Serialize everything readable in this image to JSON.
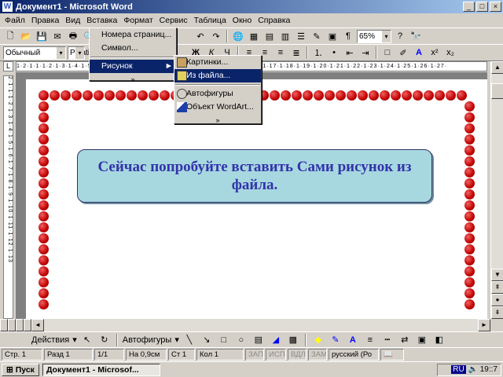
{
  "window": {
    "title": "Документ1 - Microsoft Word",
    "min": "_",
    "max": "□",
    "close": "×"
  },
  "menu": [
    "Файл",
    "Правка",
    "Вид",
    "Вставка",
    "Формат",
    "Сервис",
    "Таблица",
    "Окно",
    "Справка"
  ],
  "toolbar": {
    "zoom": "65%",
    "style": "Обычный",
    "font": "Palati"
  },
  "insert_menu": {
    "items": [
      "Номера страниц...",
      "Символ...",
      "Рисунок",
      "»"
    ]
  },
  "picture_submenu": {
    "items": [
      "Картинки...",
      "Из файла...",
      "Автофигуры",
      "Объект WordArt...",
      "»"
    ]
  },
  "ruler_text": "1·2·1·1·1·2·1·3·1·4·1·5·1·6·1·7·1·8·1·9·1·10·1·11·1·12·1·13·1·14·1·15·1·16·1·17·1·18·1·19·1·20·1·21·1·22·1·23·1·24·1·25·1·26·1·27·",
  "vruler_text": "2·1·1·1·2·1·3·1·4·1·5·1·6·1·7·1·8·1·9·1·10·1·11·1·12·1·13",
  "callout_text": "Сейчас попробуйте вставить Сами рисунок из файла.",
  "drawing": {
    "actions": "Действия",
    "autoshapes": "Автофигуры"
  },
  "status": {
    "page": "Стр. 1",
    "section": "Разд 1",
    "pages": "1/1",
    "at": "На 0,9см",
    "line": "Ст 1",
    "col": "Кол 1",
    "rec": "ЗАП",
    "trk": "ИСПР",
    "ext": "ВДЛ",
    "ovr": "ЗАМ",
    "lang": "русский (Ро"
  },
  "taskbar": {
    "start": "Пуск",
    "task": "Документ1 - Microsof...",
    "lang": "RU",
    "clock": "19::7"
  }
}
